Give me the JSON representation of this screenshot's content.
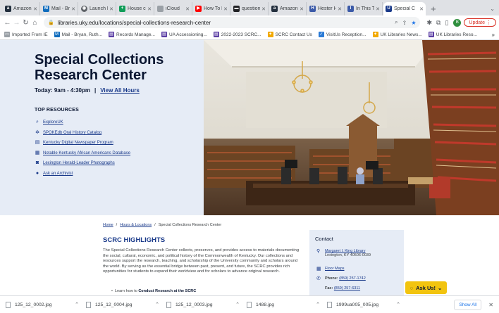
{
  "browser": {
    "tabs": [
      {
        "label": "Amazon",
        "icon": "amazon-icon"
      },
      {
        "label": "Mail - Bry",
        "icon": "mail-icon"
      },
      {
        "label": "Launch M",
        "icon": "launch-icon"
      },
      {
        "label": "House co",
        "icon": "doc-icon"
      },
      {
        "label": "iCloud",
        "icon": "apple-icon"
      },
      {
        "label": "How To K",
        "icon": "youtube-icon"
      },
      {
        "label": "question:",
        "icon": "bookmark-icon"
      },
      {
        "label": "Amazon.c",
        "icon": "amazon-icon"
      },
      {
        "label": "Hester H",
        "icon": "site-icon"
      },
      {
        "label": "In This Ti",
        "icon": "site-icon"
      },
      {
        "label": "Special C",
        "icon": "uk-icon",
        "active": true
      }
    ],
    "new_tab": "+",
    "url": "libraries.uky.edu/locations/special-collections-research-center",
    "profile_initial": "B",
    "update_label": "Update"
  },
  "bookmarks": [
    {
      "label": "Imported From IE",
      "icon": "folder-icon"
    },
    {
      "label": "Mail - Bryan, Ruth...",
      "icon": "mail-icon"
    },
    {
      "label": "Records Manage...",
      "icon": "doc-icon"
    },
    {
      "label": "UA Accessioning...",
      "icon": "doc-icon"
    },
    {
      "label": "2022-2023 SCRC...",
      "icon": "doc-icon"
    },
    {
      "label": "SCRC Contact Us",
      "icon": "uk-icon"
    },
    {
      "label": "VisitUs Reception...",
      "icon": "check-icon"
    },
    {
      "label": "UK Libraries News...",
      "icon": "uk-icon"
    },
    {
      "label": "UK Libraries Reso...",
      "icon": "doc-icon"
    }
  ],
  "hero": {
    "title": "Special Collections Research Center",
    "hours_label": "Today: 9am - 4:30pm",
    "hours_link": "View All Hours",
    "top_resources_title": "TOP RESOURCES",
    "resources": [
      {
        "label": "ExploreUK",
        "icon": "search-icon"
      },
      {
        "label": "SPOKEdb Oral History Catalog",
        "icon": "gear-icon"
      },
      {
        "label": "Kentucky Digital Newspaper Program",
        "icon": "newspaper-icon"
      },
      {
        "label": "Notable Kentucky African Americans Database",
        "icon": "database-icon"
      },
      {
        "label": "Lexington Herald-Leader Photographs",
        "icon": "camera-icon"
      },
      {
        "label": "Ask an Archivist",
        "icon": "chat-icon"
      }
    ]
  },
  "breadcrumb": [
    "Home",
    "Hours & Locations",
    "Special Collections Research Center"
  ],
  "highlights": {
    "title": "SCRC HIGHLIGHTS",
    "body": "The Special Collections Research Center collects, preserves, and provides access to materials documenting the social, cultural, economic, and political history of the Commonwealth of Kentucky. Our collections and resources support the research, teaching, and scholarship of the University community and scholars around the world. By serving as the essential bridge between past, present, and future, the SCRC provides rich opportunities for students to expand their worldview and for scholars to advance original research.",
    "bullet_prefix": "Learn how to",
    "bullet_bold": "Conduct Research at the SCRC"
  },
  "contact": {
    "title": "Contact",
    "location_link": "Margaret I. King Library",
    "address": "Lexington, KY 40506-0039",
    "floor_maps": "Floor Maps",
    "phone_label": "Phone:",
    "phone": "(859) 257-1742",
    "fax_label": "Fax:",
    "fax": "(859) 257-6311"
  },
  "ask_us": "Ask Us!",
  "downloads": {
    "files": [
      "125_12_0002.jpg",
      "125_12_0004.jpg",
      "125_12_0003.jpg",
      "1488.jpg",
      "1999ua005_005.jpg"
    ],
    "show_all": "Show All"
  }
}
